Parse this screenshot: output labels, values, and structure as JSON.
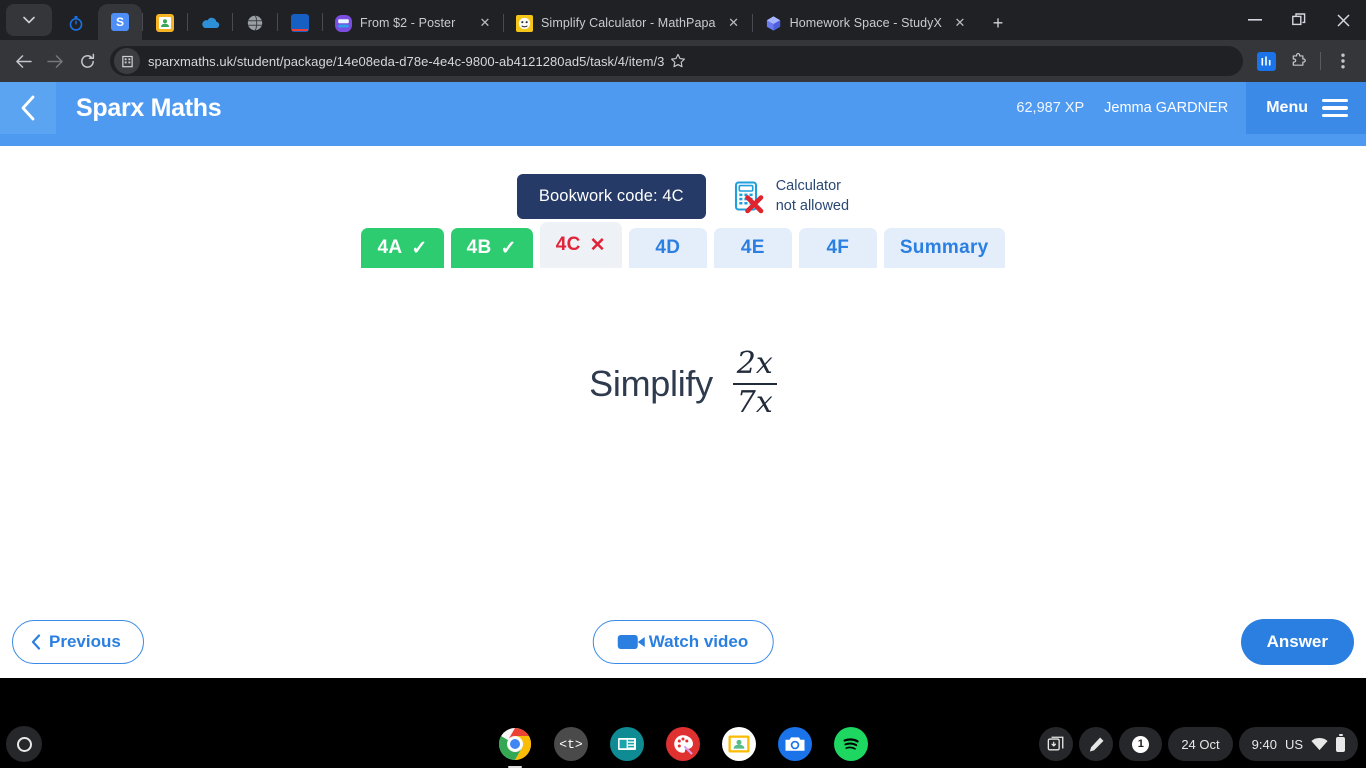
{
  "browser": {
    "tab_caret_icon": "chevron-down-icon",
    "pinned_tabs": [
      {
        "name": "stopwatch-pinned-tab",
        "icon": "stopwatch-icon"
      },
      {
        "name": "sparx-pinned-tab",
        "icon": "sparx-s-icon"
      },
      {
        "name": "contacts-pinned-tab",
        "icon": "contact-card-icon"
      },
      {
        "name": "onedrive-pinned-tab",
        "icon": "cloud-icon"
      },
      {
        "name": "globe-pinned-tab",
        "icon": "globe-icon"
      },
      {
        "name": "blue-doc-pinned-tab",
        "icon": "blue-document-icon"
      }
    ],
    "tabs": [
      {
        "title": "From $2 - Poster",
        "favicon": "purple-hex-icon",
        "close_label": "✕"
      },
      {
        "title": "Simplify Calculator - MathPapa",
        "favicon": "mathpapa-face-icon",
        "close_label": "✕"
      },
      {
        "title": "Homework Space - StudyX",
        "favicon": "studyx-cube-icon",
        "close_label": "✕"
      }
    ],
    "new_tab_label": "+",
    "window_controls": {
      "minimize": "–",
      "restore": "❐",
      "close": "✕"
    },
    "nav": {
      "back": "←",
      "forward": "→",
      "reload": "↻"
    },
    "omnibox": {
      "site_icon": "building-site-icon",
      "url": "sparxmaths.uk/student/package/14e08eda-d78e-4e4c-9800-ab4121280ad5/task/4/item/3",
      "star_icon": "bookmark-star-icon"
    },
    "toolbar_icons": [
      {
        "name": "blue-extension-icon",
        "glyph": "ᴵ"
      },
      {
        "name": "extensions-puzzle-icon",
        "glyph": ""
      },
      {
        "name": "chrome-menu-icon",
        "glyph": "⋮"
      }
    ]
  },
  "sparx": {
    "back_icon": "chevron-left-icon",
    "title": "Sparx Maths",
    "xp": "62,987 XP",
    "user": "Jemma GARDNER",
    "menu_label": "Menu",
    "menu_icon": "hamburger-icon",
    "task_tabs": [
      {
        "label": "4A",
        "mark": "✓",
        "state": "done"
      },
      {
        "label": "4B",
        "mark": "✓",
        "state": "done"
      },
      {
        "label": "4C",
        "mark": "✕",
        "state": "current"
      },
      {
        "label": "4D",
        "mark": "",
        "state": "todo"
      },
      {
        "label": "4E",
        "mark": "",
        "state": "todo"
      },
      {
        "label": "4F",
        "mark": "",
        "state": "todo"
      },
      {
        "label": "Summary",
        "mark": "",
        "state": "summary"
      }
    ],
    "bookwork_code": "Bookwork code: 4C",
    "calculator": {
      "icon": "calculator-not-allowed-icon",
      "line1": "Calculator",
      "line2": "not allowed"
    },
    "question": {
      "prompt": "Simplify",
      "fraction_numerator": "2x",
      "fraction_denominator": "7x"
    },
    "footer": {
      "previous_label": "Previous",
      "previous_icon": "chevron-left-icon",
      "video_label": "Watch video",
      "video_icon": "video-camera-icon",
      "answer_label": "Answer"
    }
  },
  "shelf": {
    "launcher_icon": "launcher-circle-icon",
    "apps": [
      {
        "name": "chrome-app-icon",
        "running": true
      },
      {
        "name": "tynker-app-icon",
        "label": "<t>",
        "running": false
      },
      {
        "name": "news-app-icon",
        "running": false
      },
      {
        "name": "paint-app-icon",
        "running": false
      },
      {
        "name": "google-classroom-app-icon",
        "running": true
      },
      {
        "name": "camera-app-icon",
        "running": false
      },
      {
        "name": "spotify-app-icon",
        "running": false
      }
    ],
    "tray": {
      "capture_icon": "screen-capture-icon",
      "stylus_icon": "stylus-pen-icon",
      "notification_count": "1",
      "date": "24 Oct",
      "time": "9:40",
      "keyboard": "US",
      "wifi_icon": "wifi-icon",
      "battery_icon": "battery-icon"
    }
  },
  "colors": {
    "sparx_blue": "#4e9af1",
    "accent_blue": "#2b7fe0",
    "done_green": "#2ecc71",
    "error_red": "#e0243a",
    "bookwork_navy": "#253a66"
  }
}
